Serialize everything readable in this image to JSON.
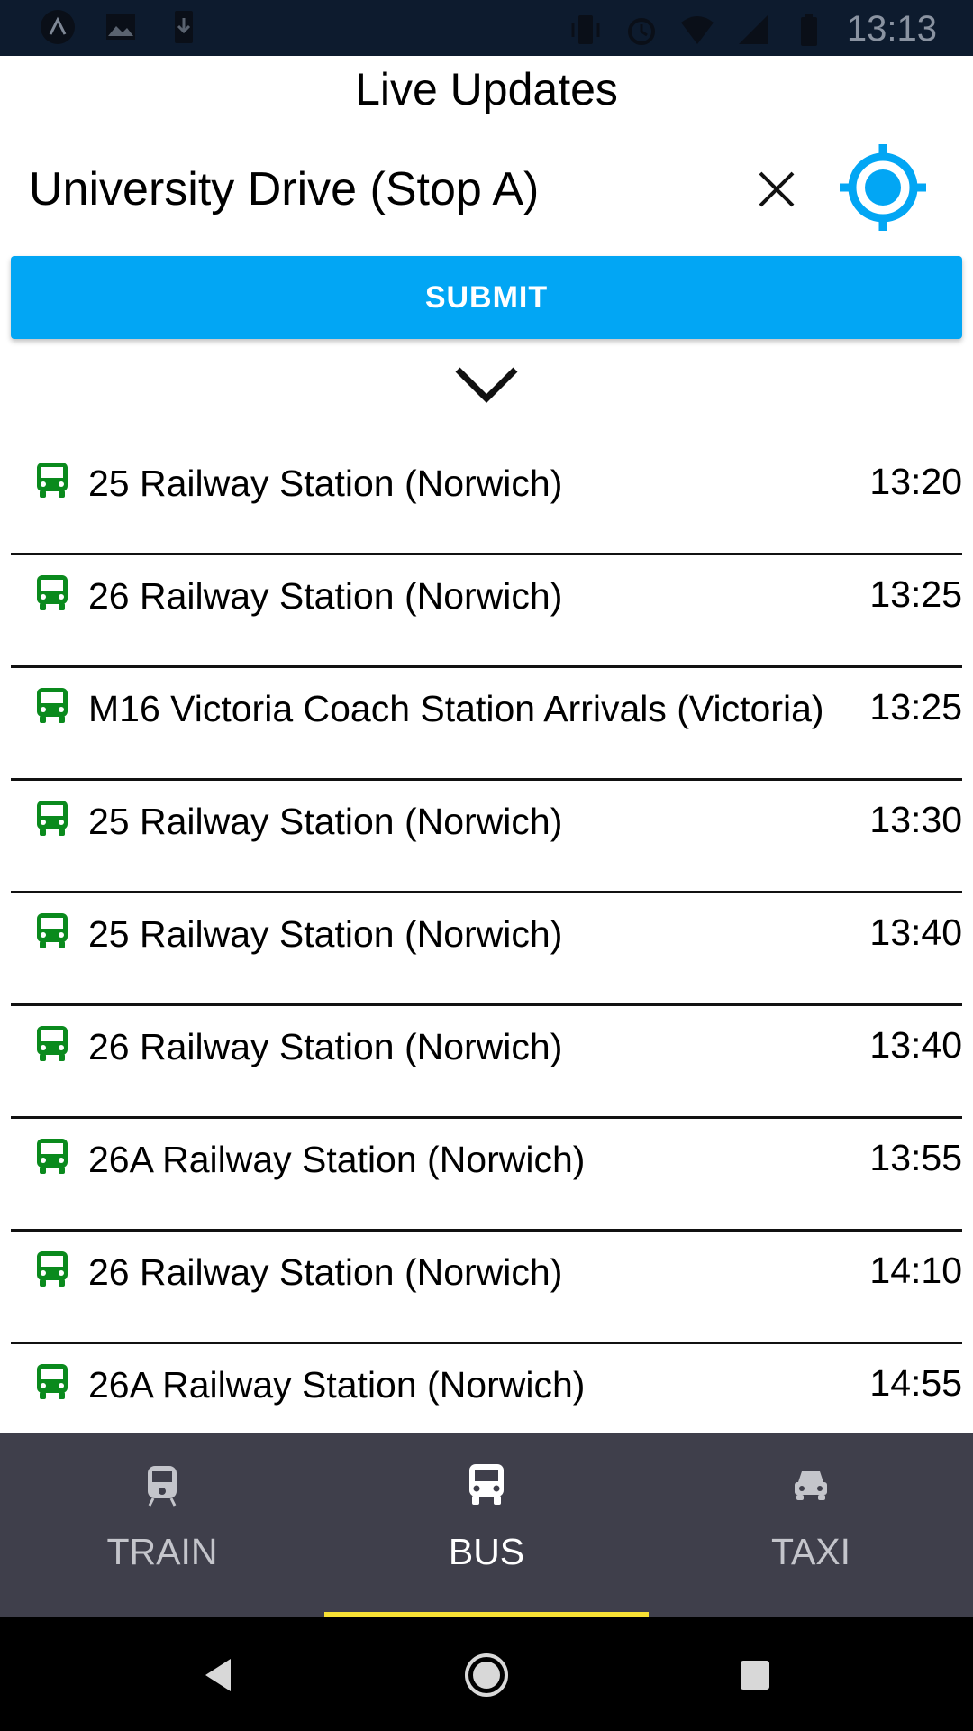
{
  "status_bar": {
    "time": "13:13",
    "left_icons": [
      "app-icon",
      "image-icon",
      "download-icon"
    ],
    "right_icons": [
      "vibrate-icon",
      "alarm-icon",
      "wifi-icon",
      "signal-icon",
      "battery-icon"
    ]
  },
  "header": {
    "title": "Live Updates",
    "stop_name": "University Drive (Stop A)"
  },
  "submit_label": "SUBMIT",
  "accent_color": "#02a6f4",
  "bus_icon_color": "#0a8a1d",
  "departures": [
    {
      "route": "25 Railway Station (Norwich)",
      "time": "13:20"
    },
    {
      "route": "26 Railway Station (Norwich)",
      "time": "13:25"
    },
    {
      "route": "M16 Victoria Coach Station Arrivals (Victoria)",
      "time": "13:25"
    },
    {
      "route": "25 Railway Station (Norwich)",
      "time": "13:30"
    },
    {
      "route": "25 Railway Station (Norwich)",
      "time": "13:40"
    },
    {
      "route": "26 Railway Station (Norwich)",
      "time": "13:40"
    },
    {
      "route": "26A Railway Station (Norwich)",
      "time": "13:55"
    },
    {
      "route": "26 Railway Station (Norwich)",
      "time": "14:10"
    },
    {
      "route": "26A Railway Station (Norwich)",
      "time": "14:55"
    }
  ],
  "bottom_nav": {
    "items": [
      {
        "label": "TRAIN",
        "icon": "train-icon"
      },
      {
        "label": "BUS",
        "icon": "bus-icon",
        "active": true
      },
      {
        "label": "TAXI",
        "icon": "car-icon"
      }
    ],
    "active_indicator_color": "#f8e134"
  },
  "system_nav": [
    "back-icon",
    "home-icon",
    "recents-icon"
  ]
}
